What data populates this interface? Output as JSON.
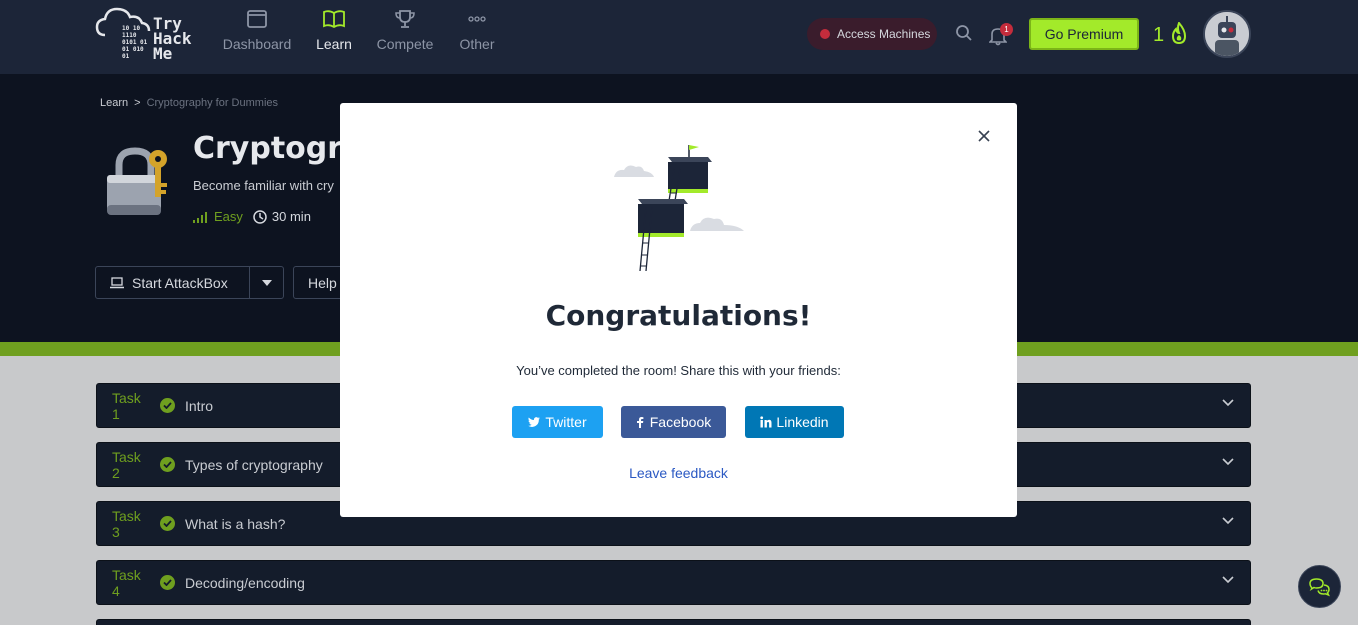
{
  "brand": {
    "logo_bits": [
      "10 10",
      "1110",
      "0101 01",
      "01 010",
      "01"
    ],
    "logo_words": [
      "Try",
      "Hack",
      "Me"
    ]
  },
  "nav": {
    "items": [
      {
        "label": "Dashboard",
        "icon": "dashboard-icon"
      },
      {
        "label": "Learn",
        "icon": "book-icon",
        "active": true
      },
      {
        "label": "Compete",
        "icon": "trophy-icon"
      },
      {
        "label": "Other",
        "icon": "more-icon"
      }
    ],
    "access_machines": "Access Machines",
    "notification_count": "1",
    "go_premium": "Go Premium",
    "streak": "1"
  },
  "breadcrumb": {
    "root": "Learn",
    "separator": ">",
    "current": "Cryptography for Dummies"
  },
  "room": {
    "title": "Cryptograp",
    "subtitle": "Become familiar with cry",
    "difficulty": "Easy",
    "duration": "30 min"
  },
  "actions": {
    "start_attackbox": "Start AttackBox",
    "help": "Help"
  },
  "tasks": [
    {
      "number": "Task 1",
      "name": "Intro"
    },
    {
      "number": "Task 2",
      "name": "Types of cryptography"
    },
    {
      "number": "Task 3",
      "name": "What is a hash?"
    },
    {
      "number": "Task 4",
      "name": "Decoding/encoding"
    }
  ],
  "modal": {
    "title": "Congratulations!",
    "message": "You’ve completed the room! Share this with your friends:",
    "share": {
      "twitter": "Twitter",
      "facebook": "Facebook",
      "linkedin": "Linkedin"
    },
    "feedback": "Leave feedback"
  },
  "colors": {
    "nav_bg": "#1c2538",
    "hero_bg": "#0d1320",
    "accent_green": "#a3ea2a",
    "task_bg": "#141c2b",
    "twitter": "#1da1f2",
    "facebook": "#3b5998",
    "linkedin": "#0077b5"
  }
}
